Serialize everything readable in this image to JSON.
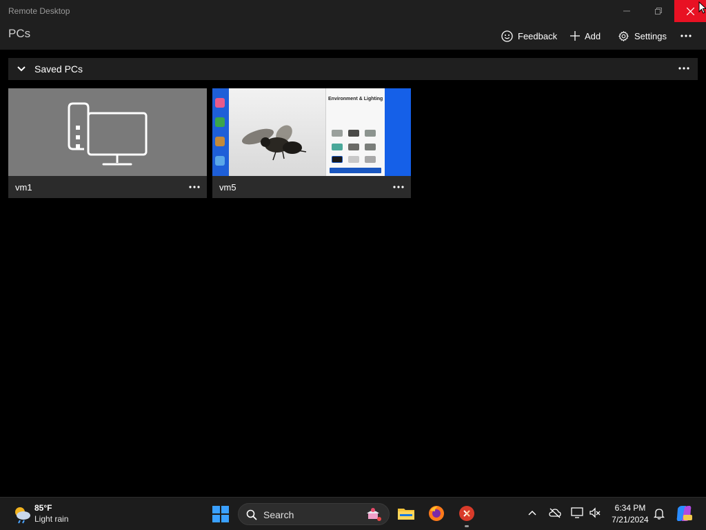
{
  "window": {
    "title": "Remote Desktop",
    "close_color": "#e81123"
  },
  "header": {
    "page_title": "PCs",
    "commands": [
      {
        "label": "Feedback",
        "icon": "smiley-icon"
      },
      {
        "label": "Add",
        "icon": "plus-icon"
      },
      {
        "label": "Settings",
        "icon": "gear-icon"
      }
    ],
    "more_icon": "more-icon"
  },
  "groups": [
    {
      "title": "Saved PCs",
      "expanded": true,
      "pcs": [
        {
          "name": "vm1",
          "thumbnail": "default-pc-icon"
        },
        {
          "name": "vm5",
          "thumbnail": "session-screenshot",
          "thumbnail_text": {
            "panel_title": "Environment & Lighting"
          }
        }
      ]
    }
  ],
  "taskbar": {
    "weather": {
      "temp": "85°F",
      "desc": "Light rain",
      "icon": "weather-rain-icon"
    },
    "search_label": "Search",
    "apps": [
      {
        "name": "file-explorer-icon"
      },
      {
        "name": "firefox-icon"
      },
      {
        "name": "remote-desktop-icon",
        "active": true
      }
    ],
    "tray_icons": [
      "chevron-up-icon",
      "onedrive-off-icon",
      "display-icon",
      "volume-muted-icon"
    ],
    "time": "6:34 PM",
    "date": "7/21/2024",
    "accent": "#0078d4"
  }
}
